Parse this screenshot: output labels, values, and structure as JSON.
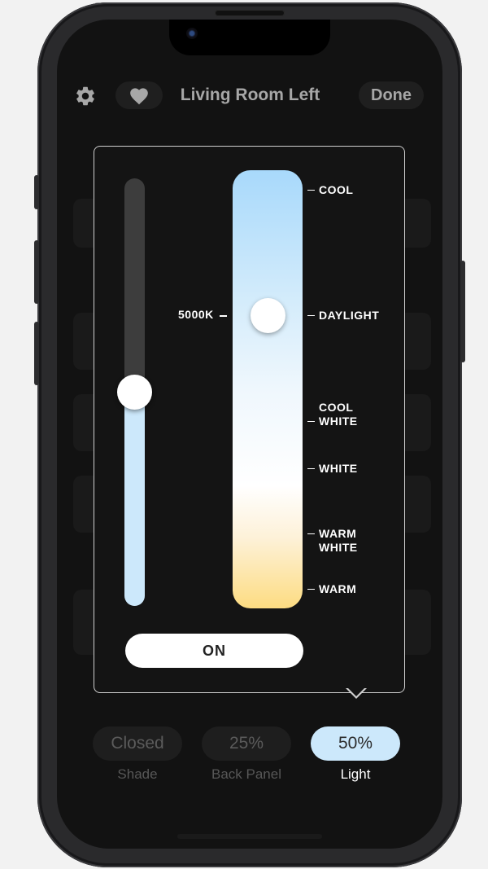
{
  "header": {
    "title": "Living Room Left",
    "done_label": "Done",
    "settings_icon": "gear-icon",
    "favorite_icon": "heart-icon"
  },
  "popover": {
    "brightness_level": 0.5,
    "color_temp": {
      "value_label": "5000K",
      "labels": [
        {
          "line1": "COOL",
          "line2": ""
        },
        {
          "line1": "DAYLIGHT",
          "line2": ""
        },
        {
          "line1": "COOL",
          "line2": "WHITE"
        },
        {
          "line1": "WHITE",
          "line2": ""
        },
        {
          "line1": "WARM",
          "line2": "WHITE"
        },
        {
          "line1": "WARM",
          "line2": ""
        }
      ]
    },
    "on_button_label": "ON"
  },
  "controls": [
    {
      "value": "Closed",
      "caption": "Shade",
      "active": false
    },
    {
      "value": "25%",
      "caption": "Back Panel",
      "active": false
    },
    {
      "value": "50%",
      "caption": "Light",
      "active": true
    }
  ],
  "colors": {
    "accent": "#cce8fb",
    "cool": "#a8d9fb",
    "warm": "#fddc82"
  }
}
